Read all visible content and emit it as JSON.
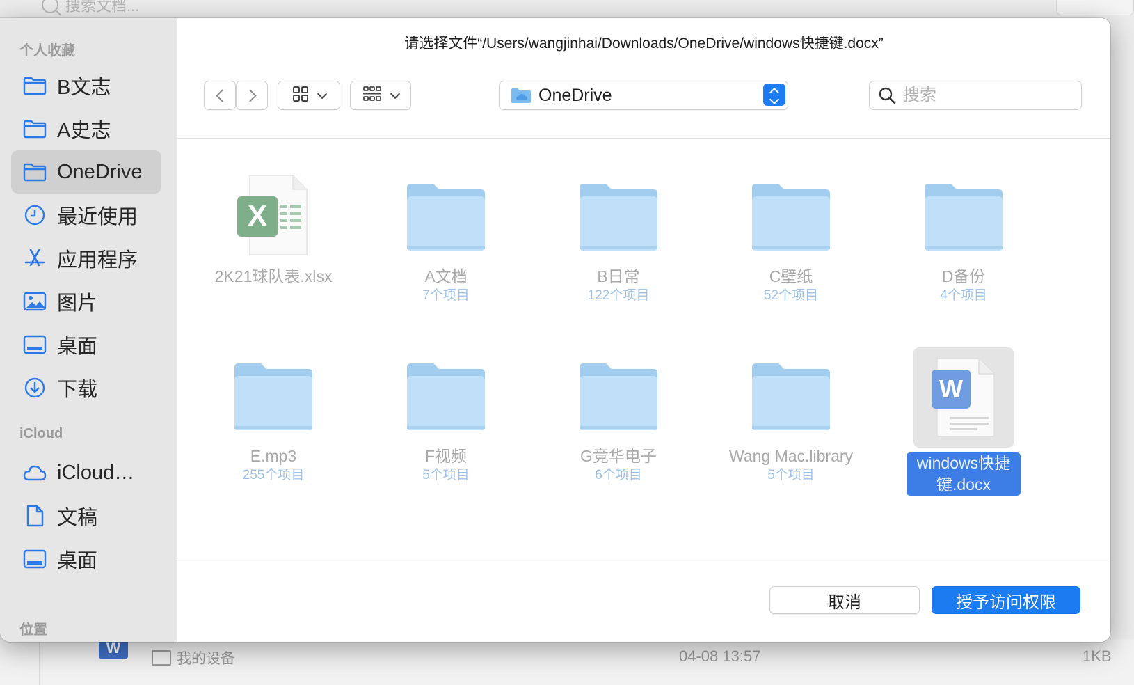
{
  "background": {
    "search_placeholder": "搜索文档...",
    "row_device": "我的设备",
    "row_date": "04-08 13:57",
    "row_size": "1KB",
    "row_word_letter": "W"
  },
  "dialog": {
    "title": "请选择文件“/Users/wangjinhai/Downloads/OneDrive/windows快捷键.docx”",
    "location": "OneDrive",
    "search_placeholder": "搜索",
    "cancel_label": "取消",
    "grant_label": "授予访问权限"
  },
  "sidebar": {
    "favorites_header": "个人收藏",
    "favorites": [
      {
        "label": "B文志",
        "icon": "folder-icon"
      },
      {
        "label": "A史志",
        "icon": "folder-icon"
      },
      {
        "label": "OneDrive",
        "icon": "folder-icon",
        "selected": true
      },
      {
        "label": "最近使用",
        "icon": "clock-icon"
      },
      {
        "label": "应用程序",
        "icon": "apps-icon"
      },
      {
        "label": "图片",
        "icon": "photo-icon"
      },
      {
        "label": "桌面",
        "icon": "desktop-icon"
      },
      {
        "label": "下载",
        "icon": "download-icon"
      }
    ],
    "icloud_header": "iCloud",
    "icloud": [
      {
        "label": "iCloud…",
        "icon": "cloud-icon"
      },
      {
        "label": "文稿",
        "icon": "document-icon"
      },
      {
        "label": "桌面",
        "icon": "desktop-icon"
      }
    ],
    "locations_header": "位置"
  },
  "files": [
    {
      "name": "2K21球队表.xlsx",
      "count": "",
      "type": "excel"
    },
    {
      "name": "A文档",
      "count": "7个项目",
      "type": "folder"
    },
    {
      "name": "B日常",
      "count": "122个项目",
      "type": "folder"
    },
    {
      "name": "C壁纸",
      "count": "52个项目",
      "type": "folder"
    },
    {
      "name": "D备份",
      "count": "4个项目",
      "type": "folder"
    },
    {
      "name": "E.mp3",
      "count": "255个项目",
      "type": "folder"
    },
    {
      "name": "F视频",
      "count": "5个项目",
      "type": "folder"
    },
    {
      "name": "G竞华电子",
      "count": "6个项目",
      "type": "folder"
    },
    {
      "name": "Wang Mac.library",
      "count": "5个项目",
      "type": "folder"
    },
    {
      "name": "windows快捷键.docx",
      "count": "",
      "type": "word",
      "selected": true
    }
  ],
  "colors": {
    "accent": "#1b7bf0",
    "folder": "#b9dcf6",
    "sidebar_icon": "#2c7ae8",
    "excel": "#7fae8a",
    "word": "#6f9be0"
  }
}
